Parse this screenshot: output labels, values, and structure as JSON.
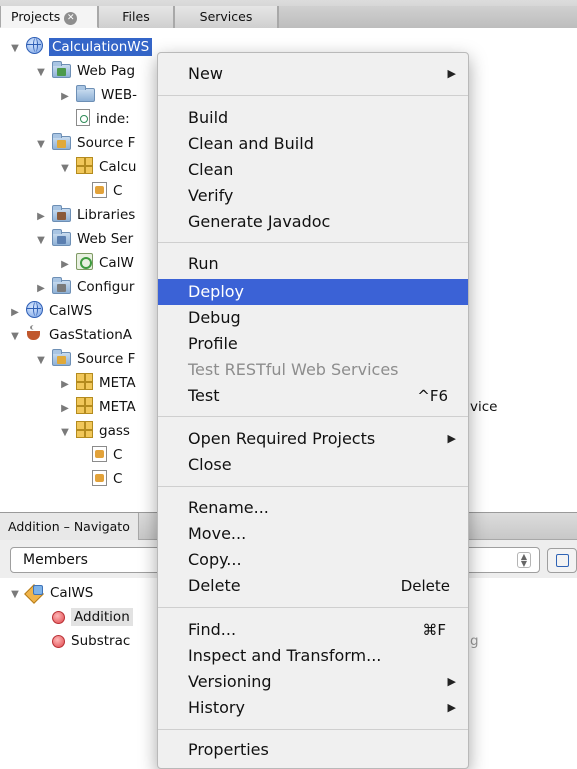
{
  "tabs": [
    {
      "label": "Projects",
      "active": true
    },
    {
      "label": "Files",
      "active": false
    },
    {
      "label": "Services",
      "active": false
    }
  ],
  "tree": {
    "calc_ws": "CalculationWS",
    "web_pages": "Web Pag",
    "web_inf": "WEB-",
    "index": "inde:",
    "source_pkgs": "Source F",
    "calc_pkg": "Calcu",
    "calc_class": "C",
    "libraries": "Libraries",
    "web_services": "Web Ser",
    "calw": "CalW",
    "config": "Configur",
    "calws": "CalWS",
    "gasstation": "GasStationA",
    "gas_source": "Source F",
    "meta1": "META",
    "meta2": "META",
    "meta2_tail": "vice",
    "gass_pkg": "gass",
    "gass_c1": "C",
    "gass_c2": "C"
  },
  "navigator": {
    "title": "Addition – Navigato",
    "filter": "Members",
    "class_name": "CalWS",
    "members": [
      "Addition",
      "Substrac"
    ],
    "member2_tail": "g"
  },
  "menu": {
    "items": [
      {
        "label": "New",
        "submenu": true
      },
      {
        "label": "Build"
      },
      {
        "label": "Clean and Build"
      },
      {
        "label": "Clean"
      },
      {
        "label": "Verify"
      },
      {
        "label": "Generate Javadoc"
      },
      {
        "label": "Run"
      },
      {
        "label": "Deploy",
        "highlighted": true
      },
      {
        "label": "Debug"
      },
      {
        "label": "Profile"
      },
      {
        "label": "Test RESTful Web Services",
        "disabled": true
      },
      {
        "label": "Test",
        "shortcut": "^F6"
      },
      {
        "label": "Open Required Projects",
        "submenu": true
      },
      {
        "label": "Close"
      },
      {
        "label": "Rename..."
      },
      {
        "label": "Move..."
      },
      {
        "label": "Copy..."
      },
      {
        "label": "Delete",
        "shortcut": "Delete"
      },
      {
        "label": "Find...",
        "shortcut": "⌘F"
      },
      {
        "label": "Inspect and Transform..."
      },
      {
        "label": "Versioning",
        "submenu": true
      },
      {
        "label": "History",
        "submenu": true
      },
      {
        "label": "Properties"
      }
    ]
  },
  "colors": {
    "selection": "#3465c8",
    "menu_highlight": "#3b62d6",
    "menu_bg": "#f0f0f0"
  }
}
